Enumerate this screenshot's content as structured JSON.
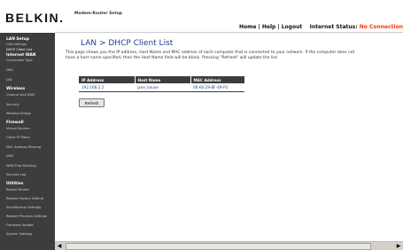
{
  "header": {
    "logo": "BELKIN.",
    "setup_title": "Modem-Router Setup",
    "links": {
      "home": "Home",
      "help": "Help",
      "logout": "Logout",
      "sep": "|"
    },
    "status_label": "Internet Status:",
    "status_value": "No Connection",
    "status_color": "#ff3300"
  },
  "sidebar": {
    "lan_setup": {
      "heading": "LAN Setup",
      "items": [
        "LAN Settings",
        "DHCP Client List"
      ]
    },
    "internet_wan": {
      "heading": "Internet WAN",
      "items": [
        "Connection Type",
        "DNS",
        "DSL"
      ]
    },
    "wireless": {
      "heading": "Wireless",
      "items": [
        "Channel and SSID",
        "Security",
        "Wireless Bridge"
      ]
    },
    "firewall": {
      "heading": "Firewall",
      "items": [
        "Virtual Servers",
        "Client IP Filters",
        "MAC Address Filtering",
        "DMZ",
        "WAN Ping Blocking",
        "Security Log"
      ]
    },
    "utilities": {
      "heading": "Utilities",
      "items": [
        "Restart Router",
        "Restore Factory Default",
        "Save/Backup Settings",
        "Restore Previous Settings",
        "Firmware Update",
        "System Settings"
      ]
    }
  },
  "main": {
    "title": "LAN > DHCP Client List",
    "description": "This page shows you the IP address, Host Name and MAC address of each computer that is connected to your network. If the computer does not have a host name specified, then the Host Name field will be blank. Pressing \"Refresh\" will update the list.",
    "table": {
      "headers": [
        "IP Address",
        "Host Name",
        "MAC Address"
      ],
      "rows": [
        [
          "192.168.2.2",
          "jane_house",
          "00-60-29-8F-49-F0"
        ]
      ]
    },
    "refresh_label": "Refresh"
  },
  "colors": {
    "sidebar_bg": "#3d3d3d",
    "title_blue": "#1c3f8c",
    "accent_red": "#ff3300"
  }
}
